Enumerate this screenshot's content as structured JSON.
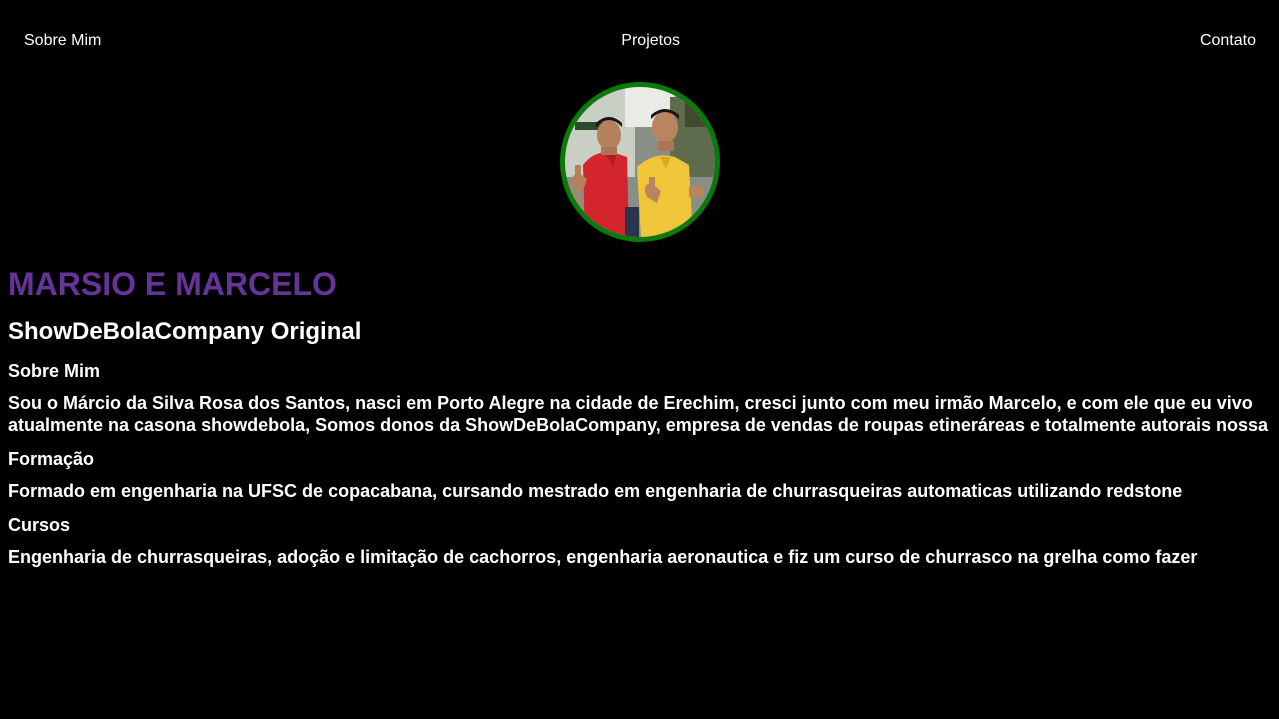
{
  "nav": {
    "items": [
      "Sobre Mim",
      "Projetos",
      "Contato"
    ]
  },
  "profile": {
    "image_alt": "Marsio e Marcelo"
  },
  "header": {
    "title": "MARSIO E MARCELO",
    "subtitle": "ShowDeBolaCompany Original"
  },
  "sections": [
    {
      "heading": "Sobre Mim",
      "text": "Sou o Márcio da Silva Rosa dos Santos, nasci em Porto Alegre na cidade de Erechim, cresci junto com meu irmão Marcelo, e com ele que eu vivo atualmente na casona showdebola, Somos donos da ShowDeBolaCompany, empresa de vendas de roupas etineráreas e totalmente autorais nossa"
    },
    {
      "heading": "Formação",
      "text": "Formado em engenharia na UFSC de copacabana, cursando mestrado em engenharia de churrasqueiras automaticas utilizando redstone"
    },
    {
      "heading": "Cursos",
      "text": "Engenharia de churrasqueiras, adoção e limitação de cachorros, engenharia aeronautica e fiz um curso de churrasco na grelha como fazer"
    }
  ],
  "colors": {
    "background": "#000000",
    "text": "#ffffff",
    "title": "#663399",
    "avatar_border": "#0a7a0a"
  }
}
